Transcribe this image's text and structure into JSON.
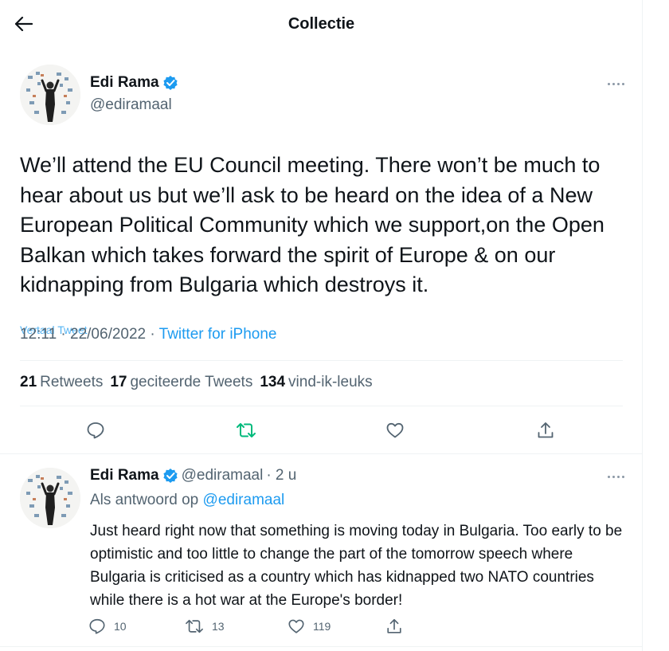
{
  "header": {
    "title": "Collectie"
  },
  "main_tweet": {
    "author_name": "Edi Rama",
    "author_handle": "@ediramaal",
    "text": "We’ll attend the EU Council meeting. There won’t be much to hear about us but we’ll ask to be heard on the idea of a New European Political Community which we support,on the Open Balkan which takes forward the spirit of Europe & on our kidnapping from Bulgaria which destroys it.",
    "translate_label": "Vertaal Tweet",
    "timestamp": "12:11 · 22/06/2022 · ",
    "source": "Twitter for iPhone",
    "stats": {
      "retweets_count": "21",
      "retweets_label": "Retweets",
      "quotes_count": "17",
      "quotes_label": "geciteerde Tweets",
      "likes_count": "134",
      "likes_label": "vind-ik-leuks"
    }
  },
  "reply_tweet": {
    "author_name": "Edi Rama",
    "author_handle": "@ediramaal",
    "time": "· 2 u",
    "reply_prefix": "Als antwoord op ",
    "reply_to": "@ediramaal",
    "text": "Just heard right now that something is moving today in Bulgaria. Too early to be optimistic and too little to change the part of the tomorrow speech where Bulgaria is criticised as a country which has kidnapped two NATO countries while there is a hot war at the Europe's border!",
    "reply_count": "10",
    "retweet_count": "13",
    "like_count": "119"
  },
  "colors": {
    "accent": "#1d9bf0",
    "retweet_green": "#00ba7c",
    "muted": "#536471",
    "text": "#0f1419"
  },
  "icons": [
    "back-arrow-icon",
    "verified-badge-icon",
    "more-icon",
    "reply-icon",
    "retweet-icon",
    "like-icon",
    "share-icon"
  ]
}
